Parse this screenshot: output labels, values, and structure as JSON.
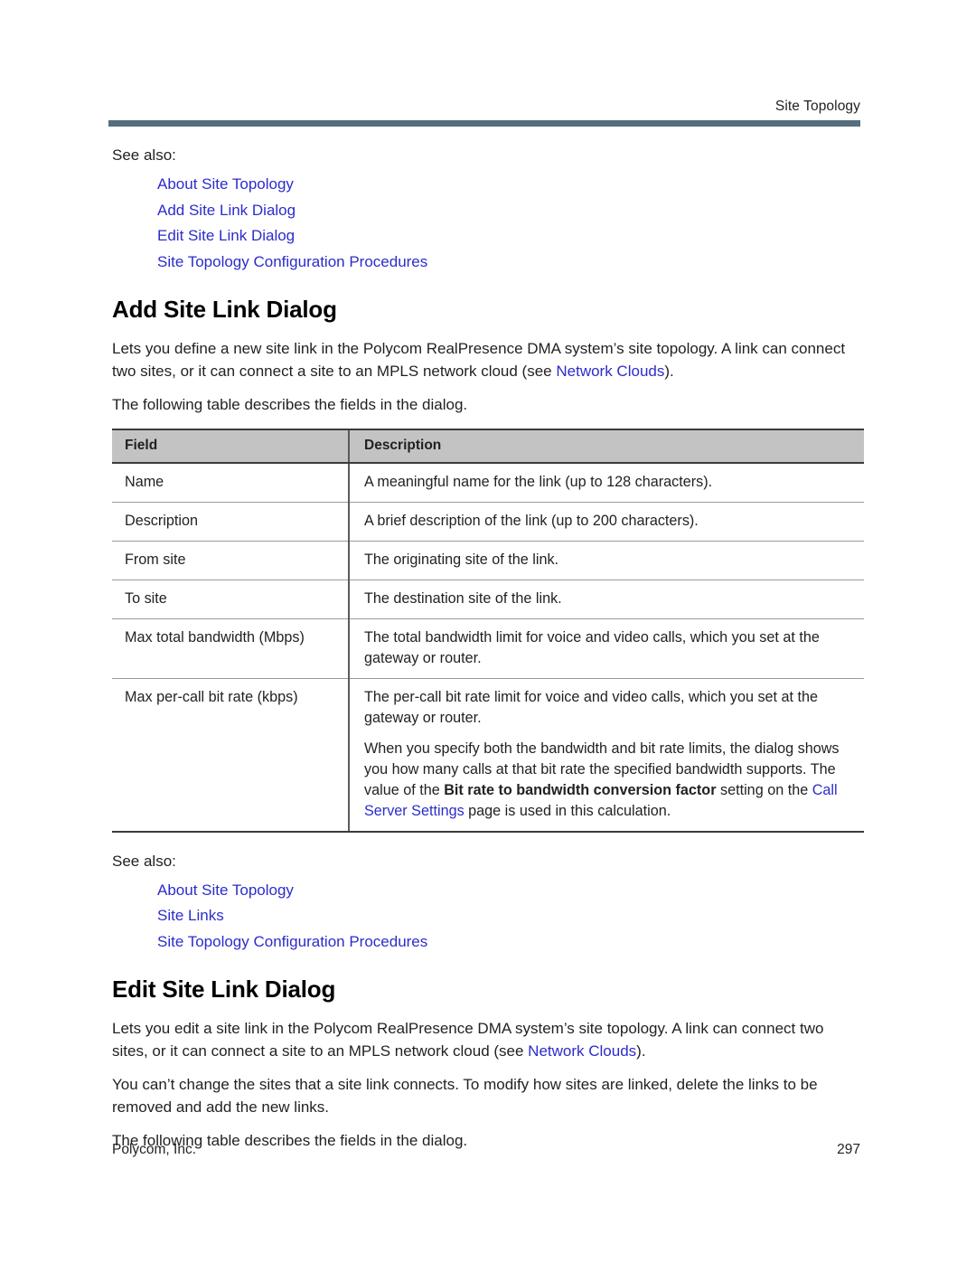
{
  "header": {
    "running_title": "Site Topology"
  },
  "footer": {
    "company": "Polycom, Inc.",
    "page_number": "297"
  },
  "colors": {
    "link": "#2c2ccc",
    "header_rule": "#546e7e",
    "table_header_bg": "#c3c3c3",
    "text": "#231f20"
  },
  "top_see_also": {
    "label": "See also:",
    "links": [
      "About Site Topology",
      "Add Site Link Dialog",
      "Edit Site Link Dialog",
      "Site Topology Configuration Procedures"
    ]
  },
  "add_section": {
    "title": "Add Site Link Dialog",
    "intro_part1": "Lets you define a new site link in the Polycom RealPresence DMA system’s site topology. A link can connect two sites, or it can connect a site to an MPLS network cloud (see ",
    "intro_link": "Network Clouds",
    "intro_part2": ").",
    "table_lead_in": "The following table describes the fields in the dialog.",
    "table": {
      "columns": [
        "Field",
        "Description"
      ],
      "rows": [
        {
          "field": "Name",
          "description": [
            "A meaningful name for the link (up to 128 characters)."
          ]
        },
        {
          "field": "Description",
          "description": [
            "A brief description of the link (up to 200 characters)."
          ]
        },
        {
          "field": "From site",
          "description": [
            "The originating site of the link."
          ]
        },
        {
          "field": "To site",
          "description": [
            "The destination site of the link."
          ]
        },
        {
          "field": "Max total bandwidth (Mbps)",
          "description": [
            "The total bandwidth limit for voice and video calls, which you set at the gateway or router."
          ]
        },
        {
          "field": "Max per-call bit rate (kbps)",
          "description": [
            "The per-call bit rate limit for voice and video calls, which you set at the gateway or router."
          ],
          "description_rich": {
            "para2_part1": "When you specify both the bandwidth and bit rate limits, the dialog shows you how many calls at that bit rate the specified bandwidth supports. The value of the ",
            "para2_bold": "Bit rate to bandwidth conversion factor",
            "para2_part2": " setting on the ",
            "para2_link": "Call Server Settings",
            "para2_part3": " page is used in this calculation."
          }
        }
      ]
    },
    "see_also": {
      "label": "See also:",
      "links": [
        "About Site Topology",
        "Site Links",
        "Site Topology Configuration Procedures"
      ]
    }
  },
  "edit_section": {
    "title": "Edit Site Link Dialog",
    "intro_part1": "Lets you edit a site link in the Polycom RealPresence DMA system’s site topology. A link can connect two sites, or it can connect a site to an MPLS network cloud (see ",
    "intro_link": "Network Clouds",
    "intro_part2": ").",
    "paragraph2": "You can’t change the sites that a site link connects. To modify how sites are linked, delete the links to be removed and add the new links.",
    "table_lead_in": "The following table describes the fields in the dialog."
  }
}
